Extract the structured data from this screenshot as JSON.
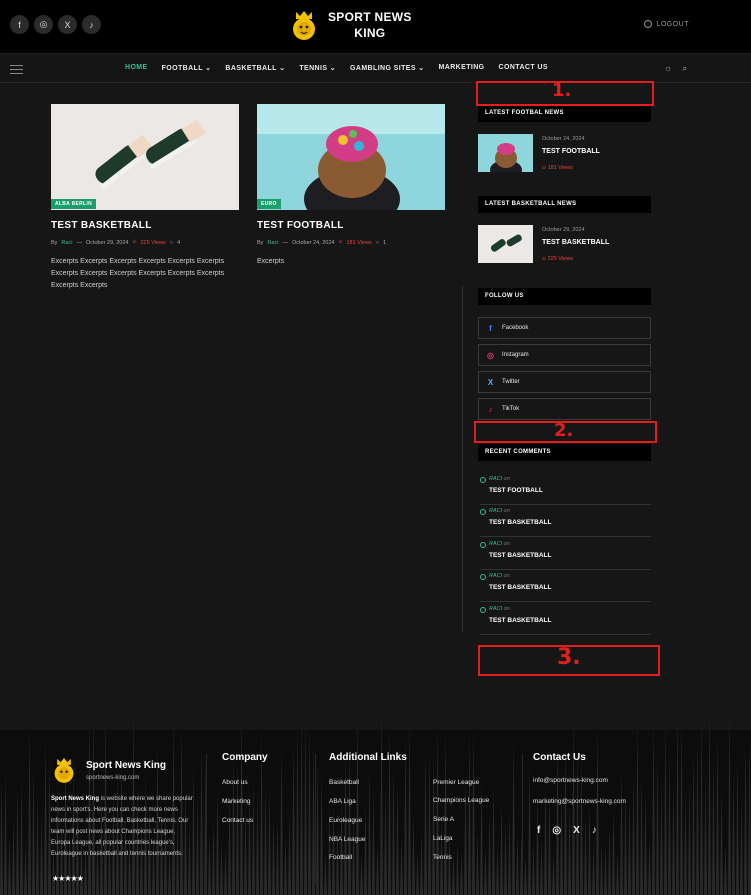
{
  "header": {
    "brand_line1": "SPORT NEWS",
    "brand_line2": "KING",
    "logout": "LOGOUT",
    "socials": [
      {
        "icon": "facebook-icon",
        "glyph": "f"
      },
      {
        "icon": "instagram-icon",
        "glyph": "◎"
      },
      {
        "icon": "x-icon",
        "glyph": "X"
      },
      {
        "icon": "tiktok-icon",
        "glyph": "♪"
      }
    ]
  },
  "nav": {
    "items": [
      {
        "label": "HOME"
      },
      {
        "label": "FOOTBALL ⌄"
      },
      {
        "label": "BASKETBALL ⌄"
      },
      {
        "label": "TENNIS ⌄"
      },
      {
        "label": "GAMBLING SITES ⌄"
      },
      {
        "label": "MARKETING"
      },
      {
        "label": "CONTACT US"
      }
    ],
    "active_color": "#35c08e"
  },
  "posts": [
    {
      "category": "ALBA BERLIN",
      "title": "TEST BASKETBALL",
      "by": "By",
      "author": "Raci",
      "date": "October 29, 2024",
      "views": "225 Views",
      "comments": "4",
      "excerpt": "Excerpts Excerpts Excerpts Excerpts Excerpts Excerpts Excerpts Excerpts Excerpts Excerpts Excerpts Excerpts Excerpts Excerpts"
    },
    {
      "category": "EURO",
      "title": "TEST FOOTBALL",
      "by": "By",
      "author": "Raci",
      "date": "October 24, 2024",
      "views": "181 Views",
      "comments": "1",
      "excerpt": "Excerpts"
    }
  ],
  "sidebar": {
    "latest_football": {
      "heading": "LATEST FOOTBAL NEWS",
      "date": "October 24, 2024",
      "title": "TEST FOOTBALL",
      "views": "181 Views"
    },
    "latest_basketball": {
      "heading": "LATEST BASKETBALL NEWS",
      "date": "October 29, 2024",
      "title": "TEST BASKETBALL",
      "views": "225 Views"
    },
    "follow_heading": "FOLLOW US",
    "follow": [
      {
        "label": "Facebook",
        "icon": "facebook-icon",
        "glyph": "f",
        "color": "#3b82f6"
      },
      {
        "label": "Instagram",
        "icon": "instagram-icon",
        "glyph": "◎",
        "color": "#e1306c"
      },
      {
        "label": "Twitter",
        "icon": "x-icon",
        "glyph": "X",
        "color": "#5aa9e6"
      },
      {
        "label": "TikTok",
        "icon": "tiktok-icon",
        "glyph": "♪",
        "color": "#ff2d55"
      }
    ],
    "comments_heading": "RECENT COMMENTS",
    "comments": [
      {
        "author": "RACI",
        "on": "on",
        "title": "TEST FOOTBALL"
      },
      {
        "author": "RACI",
        "on": "on",
        "title": "TEST BASKETBALL"
      },
      {
        "author": "RACI",
        "on": "on",
        "title": "TEST BASKETBALL"
      },
      {
        "author": "RACI",
        "on": "on",
        "title": "TEST BASKETBALL"
      },
      {
        "author": "RACI",
        "on": "on",
        "title": "TEST BASKETBALL"
      }
    ]
  },
  "annotations": [
    "1.",
    "2.",
    "3."
  ],
  "footer": {
    "brand": "Sport News King",
    "url": "sportnews-king.com",
    "about_bold": "Sport News King",
    "about": " is website where we share popular news in sport's. Here you can check more news informations about Football, Basketball, Tennis. Our team will post news about Champions League, Europa League, all popular countries league's, Euroleague in basketball and tennis tournaments.",
    "stars": "★★★★★",
    "company_title": "Company",
    "company_links": [
      "About us",
      "Marketing",
      "Contact us"
    ],
    "additional_title": "Additional Links",
    "additional_col1": [
      "Basketball",
      "ABA Liga",
      "Euroleague",
      "NBA League",
      "Football"
    ],
    "additional_col2": [
      "Premier League",
      "Champions League",
      "Serie A",
      "LaLiga",
      "Tennis"
    ],
    "contact_title": "Contact Us",
    "emails": [
      "info@sportnews-king.com",
      "marketing@sportnews-king.com"
    ],
    "socials": [
      {
        "icon": "facebook-icon",
        "glyph": "f"
      },
      {
        "icon": "instagram-icon",
        "glyph": "◎"
      },
      {
        "icon": "x-icon",
        "glyph": "X"
      },
      {
        "icon": "tiktok-icon",
        "glyph": "♪"
      }
    ]
  }
}
